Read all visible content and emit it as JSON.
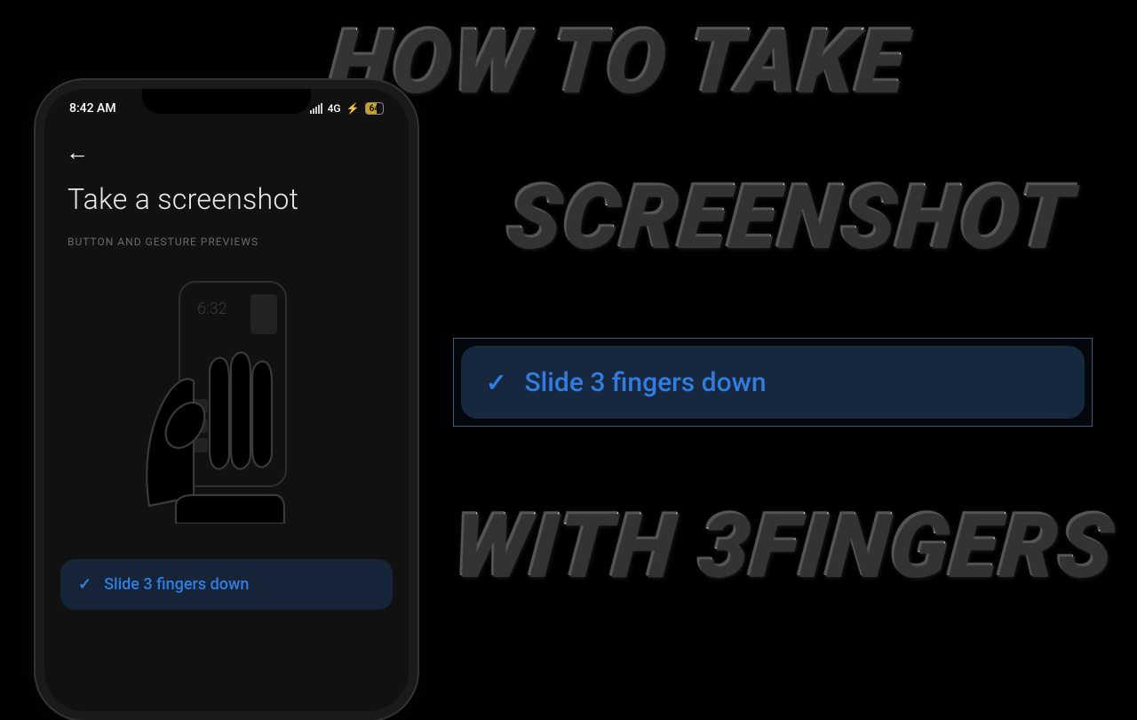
{
  "thumbnail": {
    "line1": "HOW TO TAKE",
    "line2": "SCREENSHOT",
    "line3": "WITH 3FINGERS"
  },
  "phone": {
    "status": {
      "time": "8:42 AM",
      "network": "4G",
      "battery": "64"
    },
    "page_title": "Take a screenshot",
    "section_label": "BUTTON AND GESTURE PREVIEWS",
    "preview_time": "6:32",
    "option_label": "Slide 3 fingers down"
  },
  "highlight": {
    "label": "Slide 3 fingers down"
  }
}
